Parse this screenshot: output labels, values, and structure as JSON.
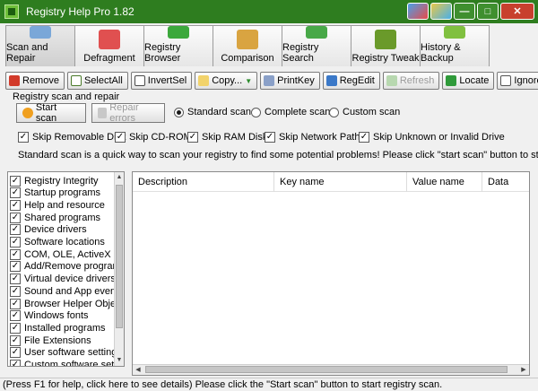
{
  "window": {
    "title": "Registry Help Pro 1.82"
  },
  "colors": {
    "titlebar": "#2e7d1f",
    "close": "#c8402e"
  },
  "tabs": [
    {
      "label": "Scan and Repair",
      "icon": "tools-icon",
      "color": "#7aa7d8",
      "active": true
    },
    {
      "label": "Defragment",
      "icon": "defragment-icon",
      "color": "#e05050",
      "active": false
    },
    {
      "label": "Registry Browser",
      "icon": "cubes-icon",
      "color": "#3ca83c",
      "active": false
    },
    {
      "label": "Comparison",
      "icon": "scales-icon",
      "color": "#d9a441",
      "active": false
    },
    {
      "label": "Registry Search",
      "icon": "magnifier-icon",
      "color": "#48a848",
      "active": false
    },
    {
      "label": "Registry Tweak",
      "icon": "wrench-cube-icon",
      "color": "#6a9a2a",
      "active": false
    },
    {
      "label": "History & Backup",
      "icon": "clock-icon",
      "color": "#80c040",
      "active": false
    }
  ],
  "toolbar": {
    "remove": "Remove",
    "select_all": "SelectAll",
    "invert_sel": "InvertSel",
    "copy": "Copy...",
    "print_key": "PrintKey",
    "reg_edit": "RegEdit",
    "refresh": "Refresh",
    "locate": "Locate",
    "ignore_list": "IgnoreList"
  },
  "scan": {
    "group_title": "Registry scan and repair",
    "start_scan": "Start scan",
    "repair_errors": "Repair errors",
    "modes": [
      "Standard scan",
      "Complete scan",
      "Custom scan"
    ],
    "selected_mode": "Standard scan",
    "skip_options": [
      "Skip Removable Disk",
      "Skip CD-ROM",
      "Skip RAM Disk",
      "Skip Network Path",
      "Skip Unknown or Invalid Drive"
    ],
    "description": "Standard scan is a quick way to scan your registry to find some potential problems! Please click \"start scan\" button to start."
  },
  "categories": [
    "Registry Integrity",
    "Startup programs",
    "Help and resource",
    "Shared programs",
    "Device drivers",
    "Software locations",
    "COM, OLE, ActiveX cont",
    "Add/Remove programs",
    "Virtual device drivers",
    "Sound and App events",
    "Browser Helper Objects",
    "Windows fonts",
    "Installed programs",
    "File Extensions",
    "User software settings",
    "Custom software settin"
  ],
  "grid": {
    "columns": [
      "Description",
      "Key name",
      "Value name",
      "Data"
    ]
  },
  "status": {
    "text": "(Press F1 for help, click here to see details) Please click the \"Start scan\" button to start registry scan."
  }
}
